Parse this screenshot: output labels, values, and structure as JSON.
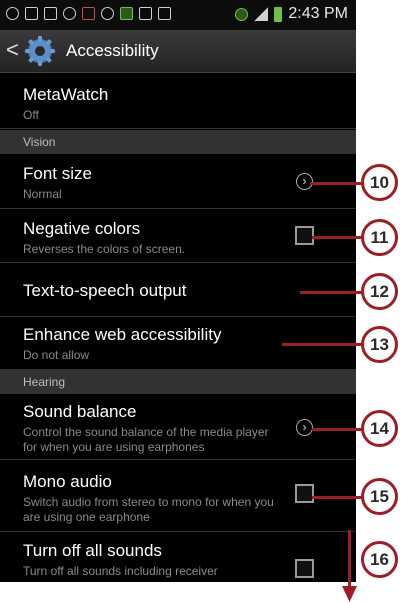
{
  "status_bar": {
    "time": "2:43 PM",
    "icons": [
      "usb-icon",
      "mail-icon",
      "mail-icon",
      "wifi-icon",
      "app-icon",
      "circle-icon",
      "android-icon",
      "bluetooth-icon",
      "mute-icon",
      "wifi-icon",
      "signal-icon",
      "battery-icon"
    ]
  },
  "action_bar": {
    "back": "<",
    "title": "Accessibility",
    "icon": "gear-icon"
  },
  "items": {
    "metawatch": {
      "title": "MetaWatch",
      "subtitle": "Off"
    },
    "vision_header": "Vision",
    "font_size": {
      "title": "Font size",
      "subtitle": "Normal"
    },
    "negative_colors": {
      "title": "Negative colors",
      "subtitle": "Reverses the colors of screen."
    },
    "tts": {
      "title": "Text-to-speech output"
    },
    "web_access": {
      "title": "Enhance web accessibility",
      "subtitle": "Do not allow"
    },
    "hearing_header": "Hearing",
    "sound_balance": {
      "title": "Sound balance",
      "subtitle": "Control the sound balance of the media player for when you are using earphones"
    },
    "mono_audio": {
      "title": "Mono audio",
      "subtitle": "Switch audio from stereo to mono for when you are using one earphone"
    },
    "turn_off_sounds": {
      "title": "Turn off all sounds",
      "subtitle": "Turn off all sounds including receiver"
    }
  },
  "callouts": [
    "10",
    "11",
    "12",
    "13",
    "14",
    "15",
    "16"
  ],
  "colors": {
    "callout": "#9b1f24",
    "background": "#000000",
    "section": "#323232"
  }
}
